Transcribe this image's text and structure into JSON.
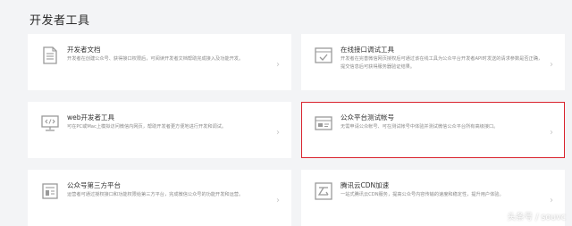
{
  "page": {
    "title": "开发者工具",
    "watermark": "头条号 / souvc"
  },
  "colors": {
    "background": "#f3f4f6",
    "card": "#ffffff",
    "highlight": "#d9232d",
    "icon": "#9a9a9a"
  },
  "tools": [
    {
      "name": "开发者文档",
      "desc": "开发者在创建公众号、获得接口权限后，可阅读开发者文档帮助完成接入及功能开发。",
      "icon": "document-icon"
    },
    {
      "name": "在线接口调试工具",
      "desc": "开发者在完善微信网页授权后可通过该在线工具为公众平台开发者API时发送的请求参数是否正确，提交信息后可获得服务器验证结果。",
      "icon": "browser-check-icon"
    },
    {
      "name": "web开发者工具",
      "desc": "可在PC或Mac上模拟访问微信内网页，帮助开发者更方便地进行开发和调试。",
      "icon": "monitor-code-icon"
    },
    {
      "name": "公众平台测试帐号",
      "desc": "无需申请公众帐号、可在测试帐号中体验并测试微信公众平台所有高级接口。",
      "icon": "window-test-icon"
    },
    {
      "name": "公众号第三方平台",
      "desc": "运营者可通过授权接口和功能权限给第三方平台，完成微信公众号的功能开发和运营。",
      "icon": "third-party-icon"
    },
    {
      "name": "腾讯云CDN加速",
      "desc": "一站式腾讯云CDN服务，提高公众号内容传输的速度和稳定性，提升用户体验。",
      "icon": "cloud-icon"
    }
  ]
}
